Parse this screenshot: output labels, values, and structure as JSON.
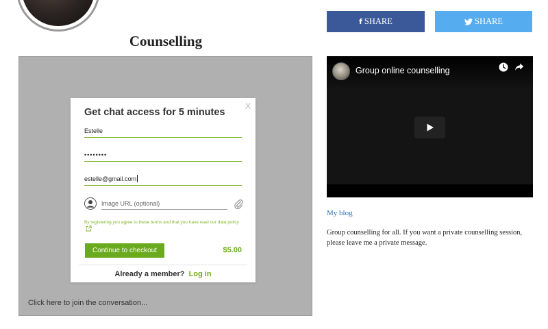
{
  "profile": {
    "title": "Counselling"
  },
  "chat": {
    "hint": "Click here to join the conversation...",
    "modal": {
      "close": "X",
      "title": "Get chat access for 5 minutes",
      "name_value": "Estelle",
      "password_value": "••••••••",
      "email_value": "estelle@gmail.com",
      "image_url_placeholder": "Image URL (optional)",
      "terms_text": "By registering you agree to these terms and that you have read our data policy",
      "checkout_label": "Continue to checkout",
      "price": "$5.00",
      "member_text": "Already a member?",
      "login_label": "Log in"
    }
  },
  "share": {
    "facebook_label": "SHARE",
    "twitter_label": "SHARE"
  },
  "video": {
    "title": "Group online counselling"
  },
  "sidebar": {
    "blog_link": "My blog",
    "description": "Group counselling for all. If you want a private counselling session, please leave me a private message."
  },
  "colors": {
    "accent_green": "#6aaa1e",
    "field_line_green": "#7fb52a",
    "facebook_blue": "#3b5998",
    "twitter_blue": "#55acee",
    "link_blue": "#2a6db8",
    "panel_gray": "#b0b0b0"
  },
  "icons": {
    "facebook": "facebook-icon",
    "twitter": "twitter-icon",
    "clock": "clock-icon",
    "share_arrow": "share-arrow-icon",
    "play": "play-icon",
    "user": "user-icon",
    "clip": "paperclip-icon",
    "external": "external-link-icon"
  }
}
